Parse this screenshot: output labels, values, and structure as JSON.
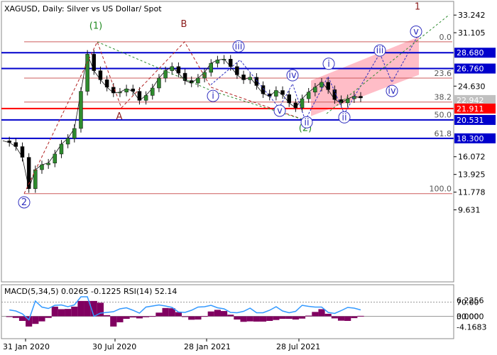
{
  "chart_data": {
    "type": "candlestick",
    "symbol_info": "XAGUSD, Daily:  Silver vs US Dollar/ Spot",
    "price_axis": {
      "range": [
        8.4,
        34.3
      ],
      "ticks": [
        "33.242",
        "31.105",
        "28.680",
        "26.760",
        "24.630",
        "22.942",
        "21.911",
        "20.531",
        "18.300",
        "16.072",
        "13.925",
        "11.778",
        "9.631"
      ]
    },
    "date_axis": {
      "labels": [
        "31 Jan 2020",
        "30 Jul 2020",
        "28 Jan 2021",
        "28 Jul 2021"
      ]
    },
    "price_series": {
      "description": "approximate daily closes, weekly sampling",
      "closes": [
        18.0,
        17.8,
        17.3,
        16.0,
        12.2,
        14.5,
        15.1,
        15.3,
        16.4,
        17.6,
        18.3,
        19.5,
        24.0,
        28.5,
        26.5,
        25.4,
        24.5,
        23.8,
        23.9,
        24.3,
        24.0,
        22.9,
        23.5,
        24.4,
        25.6,
        26.5,
        27.0,
        26.2,
        25.3,
        25.0,
        25.6,
        26.3,
        27.4,
        27.8,
        27.9,
        27.0,
        26.0,
        25.4,
        25.7,
        24.7,
        23.7,
        23.4,
        24.1,
        23.6,
        22.6,
        22.0,
        23.1,
        23.9,
        24.5,
        25.1,
        24.2,
        23.0,
        22.6,
        23.1,
        23.4,
        23.2
      ]
    },
    "horizontal_levels": [
      {
        "value": 28.68,
        "label": "28.680",
        "color": "#0000cc"
      },
      {
        "value": 26.76,
        "label": "26.760",
        "color": "#0000cc"
      },
      {
        "value": 21.911,
        "label": "21.911",
        "color": "#ff0000"
      },
      {
        "value": 20.531,
        "label": "20.531",
        "color": "#0000cc"
      },
      {
        "value": 18.3,
        "label": "18.300",
        "color": "#0000cc"
      }
    ],
    "fib_levels": [
      {
        "label": "0.0",
        "value": 30.0
      },
      {
        "label": "23.6",
        "value": 25.6
      },
      {
        "label": "38.2",
        "value": 22.7
      },
      {
        "label": "50.0",
        "value": 20.55
      },
      {
        "label": "61.8",
        "value": 18.3
      },
      {
        "label": "100.0",
        "value": 11.6
      }
    ],
    "current_price": "22.942",
    "wave_labels": [
      "2",
      "(1)",
      "A",
      "B",
      "(2)",
      "1",
      "i",
      "ii",
      "iii",
      "iv",
      "v",
      "i",
      "ii",
      "iii",
      "iv",
      "v"
    ],
    "indicator": {
      "title": "MACD(5,34,5) 0.0265 -0.1225 RSI(14) 52.14",
      "left_ticks": [
        "6.2256",
        "0.0000",
        "-4.1683"
      ],
      "right_ticks": [
        "70.00",
        "30.00"
      ]
    },
    "colors": {
      "support_line": "#0000cc",
      "resistance_line": "#ff0000",
      "fib_line": "#cd5c5c",
      "channel_fill": "#ffb6c1",
      "rsi_line": "#3399ff",
      "macd_hist": "#800060",
      "wave_primary": "#8b1a1a",
      "wave_intermediate": "#228b22",
      "wave_minor": "#2f2fbf"
    }
  }
}
